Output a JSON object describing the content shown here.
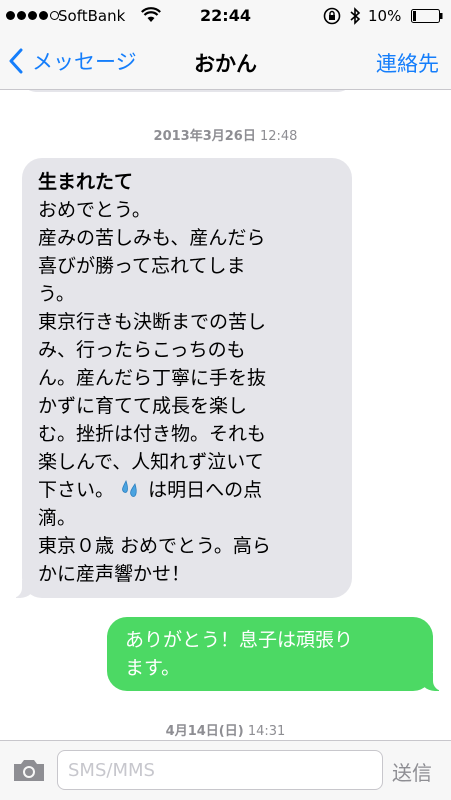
{
  "status_bar": {
    "carrier": "SoftBank",
    "time": "22:44",
    "battery": "10%"
  },
  "nav": {
    "back_label": "メッセージ",
    "title": "おかん",
    "contact_label": "連絡先"
  },
  "conversation": {
    "timestamps": [
      {
        "date": "2013年3月26日",
        "time": " 12:48"
      },
      {
        "date": "4月14日(日)",
        "time": " 14:31"
      }
    ],
    "incoming": {
      "headline": "生まれたて",
      "lines": [
        "おめでとう。",
        "産みの苦しみも、産んだら",
        "喜びが勝って忘れてしま",
        "う。",
        "東京行きも決断までの苦し",
        "み、行ったらこっちのも",
        "ん。産んだら丁寧に手を抜",
        "かずに育てて成長を楽し",
        "む。挫折は付き物。それも",
        "楽しんで、人知れず泣いて",
        "下さい。",
        "は明日への点",
        "滴。",
        "東京０歳 おめでとう。高ら",
        "かに産声響かせ！"
      ]
    },
    "outgoing": {
      "lines": [
        "ありがとう！息子は頑張り",
        "ます。"
      ]
    }
  },
  "input": {
    "placeholder": "SMS/MMS",
    "value": "",
    "send_label": "送信"
  },
  "colors": {
    "accent": "#157efb",
    "incoming_bubble": "#e5e5ea",
    "outgoing_bubble": "#4cd964"
  },
  "icons": [
    "wifi-icon",
    "rotation-lock-icon",
    "bluetooth-icon",
    "battery-icon",
    "chevron-left-icon",
    "sweat-drops-icon",
    "camera-icon"
  ]
}
